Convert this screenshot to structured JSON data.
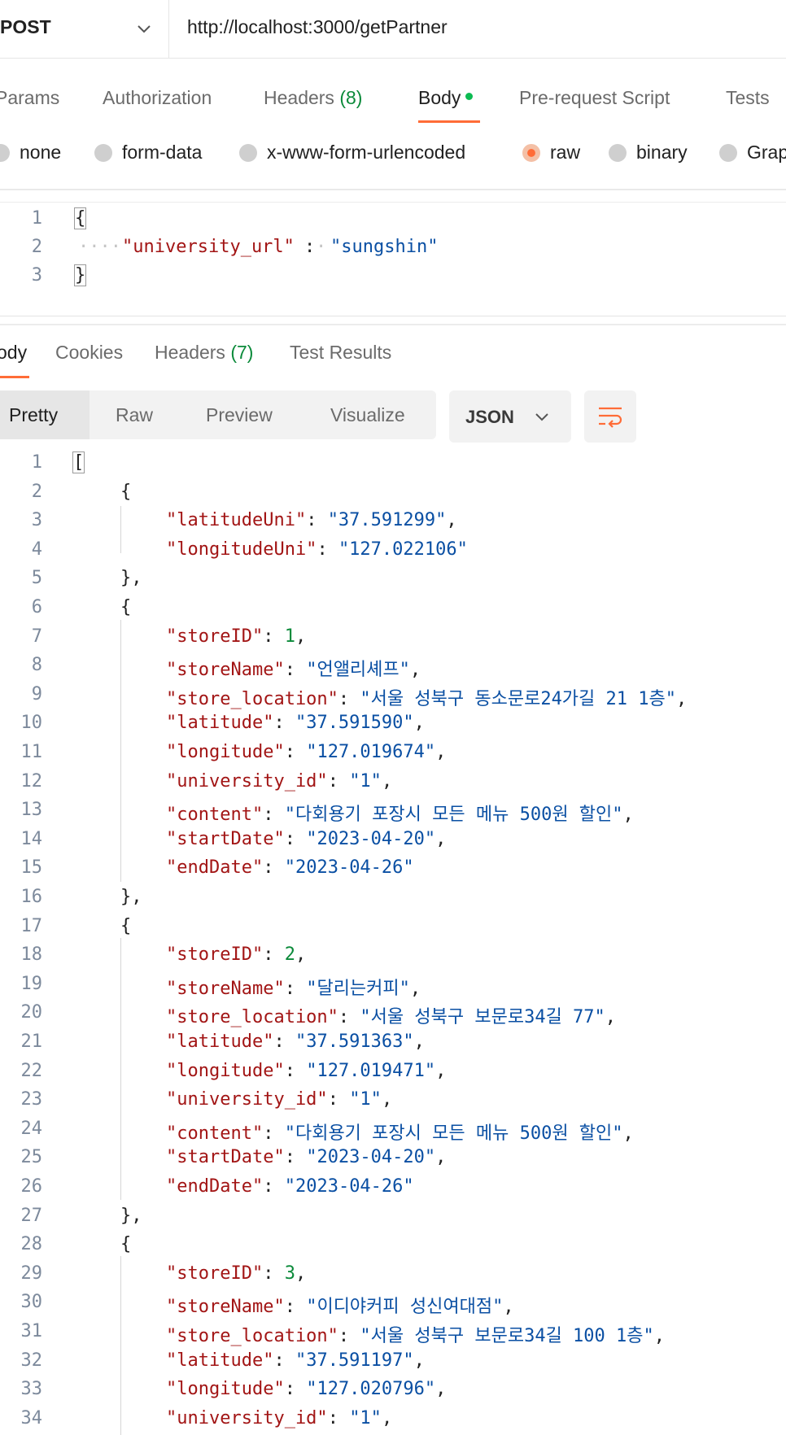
{
  "request": {
    "method": "POST",
    "url": "http://localhost:3000/getPartner"
  },
  "request_tabs": [
    {
      "label": "Params",
      "count": ""
    },
    {
      "label": "Authorization",
      "count": ""
    },
    {
      "label": "Headers",
      "count": "(8)"
    },
    {
      "label": "Body",
      "count": ""
    },
    {
      "label": "Pre-request Script",
      "count": ""
    },
    {
      "label": "Tests",
      "count": ""
    }
  ],
  "active_request_tab": "Body",
  "body_types": [
    "none",
    "form-data",
    "x-www-form-urlencoded",
    "raw",
    "binary",
    "Grap"
  ],
  "selected_body_type": "raw",
  "request_body": {
    "line_numbers": [
      "1",
      "2",
      "3"
    ],
    "open": "{",
    "key": "\"university_url\"",
    "colon": ":",
    "value": "\"sungshin\"",
    "close": "}"
  },
  "response_tabs": [
    {
      "label": "ody",
      "count": ""
    },
    {
      "label": "Cookies",
      "count": ""
    },
    {
      "label": "Headers",
      "count": "(7)"
    },
    {
      "label": "Test Results",
      "count": ""
    }
  ],
  "view_modes": [
    "Pretty",
    "Raw",
    "Preview",
    "Visualize"
  ],
  "active_view_mode": "Pretty",
  "format": "JSON",
  "icons": {
    "method_dropdown": "chevron-down-icon",
    "format_dropdown": "chevron-down-icon",
    "wrap": "wrap-lines-icon"
  },
  "colors": {
    "accent": "#ff6c37",
    "json_key": "#a21515",
    "json_string": "#0a4fa3",
    "json_number": "#0b8a3a",
    "count": "#0b8a3a",
    "dot": "#0cbb52"
  },
  "response_lines": [
    {
      "n": "1",
      "indent": 0,
      "parts": [
        [
          "punc",
          "["
        ]
      ]
    },
    {
      "n": "2",
      "indent": 1,
      "parts": [
        [
          "punc",
          "{"
        ]
      ]
    },
    {
      "n": "3",
      "indent": 2,
      "parts": [
        [
          "key",
          "\"latitudeUni\""
        ],
        [
          "punc",
          ": "
        ],
        [
          "str",
          "\"37.591299\""
        ],
        [
          "punc",
          ","
        ]
      ]
    },
    {
      "n": "4",
      "indent": 2,
      "parts": [
        [
          "key",
          "\"longitudeUni\""
        ],
        [
          "punc",
          ": "
        ],
        [
          "str",
          "\"127.022106\""
        ]
      ]
    },
    {
      "n": "5",
      "indent": 1,
      "parts": [
        [
          "punc",
          "},"
        ]
      ]
    },
    {
      "n": "6",
      "indent": 1,
      "parts": [
        [
          "punc",
          "{"
        ]
      ]
    },
    {
      "n": "7",
      "indent": 2,
      "parts": [
        [
          "key",
          "\"storeID\""
        ],
        [
          "punc",
          ": "
        ],
        [
          "num",
          "1"
        ],
        [
          "punc",
          ","
        ]
      ]
    },
    {
      "n": "8",
      "indent": 2,
      "parts": [
        [
          "key",
          "\"storeName\""
        ],
        [
          "punc",
          ": "
        ],
        [
          "str",
          "\"언앨리셰프\""
        ],
        [
          "punc",
          ","
        ]
      ]
    },
    {
      "n": "9",
      "indent": 2,
      "parts": [
        [
          "key",
          "\"store_location\""
        ],
        [
          "punc",
          ": "
        ],
        [
          "str",
          "\"서울 성북구 동소문로24가길 21 1층\""
        ],
        [
          "punc",
          ","
        ]
      ]
    },
    {
      "n": "10",
      "indent": 2,
      "parts": [
        [
          "key",
          "\"latitude\""
        ],
        [
          "punc",
          ": "
        ],
        [
          "str",
          "\"37.591590\""
        ],
        [
          "punc",
          ","
        ]
      ]
    },
    {
      "n": "11",
      "indent": 2,
      "parts": [
        [
          "key",
          "\"longitude\""
        ],
        [
          "punc",
          ": "
        ],
        [
          "str",
          "\"127.019674\""
        ],
        [
          "punc",
          ","
        ]
      ]
    },
    {
      "n": "12",
      "indent": 2,
      "parts": [
        [
          "key",
          "\"university_id\""
        ],
        [
          "punc",
          ": "
        ],
        [
          "str",
          "\"1\""
        ],
        [
          "punc",
          ","
        ]
      ]
    },
    {
      "n": "13",
      "indent": 2,
      "parts": [
        [
          "key",
          "\"content\""
        ],
        [
          "punc",
          ": "
        ],
        [
          "str",
          "\"다회용기 포장시 모든 메뉴 500원 할인\""
        ],
        [
          "punc",
          ","
        ]
      ]
    },
    {
      "n": "14",
      "indent": 2,
      "parts": [
        [
          "key",
          "\"startDate\""
        ],
        [
          "punc",
          ": "
        ],
        [
          "str",
          "\"2023-04-20\""
        ],
        [
          "punc",
          ","
        ]
      ]
    },
    {
      "n": "15",
      "indent": 2,
      "parts": [
        [
          "key",
          "\"endDate\""
        ],
        [
          "punc",
          ": "
        ],
        [
          "str",
          "\"2023-04-26\""
        ]
      ]
    },
    {
      "n": "16",
      "indent": 1,
      "parts": [
        [
          "punc",
          "},"
        ]
      ]
    },
    {
      "n": "17",
      "indent": 1,
      "parts": [
        [
          "punc",
          "{"
        ]
      ]
    },
    {
      "n": "18",
      "indent": 2,
      "parts": [
        [
          "key",
          "\"storeID\""
        ],
        [
          "punc",
          ": "
        ],
        [
          "num",
          "2"
        ],
        [
          "punc",
          ","
        ]
      ]
    },
    {
      "n": "19",
      "indent": 2,
      "parts": [
        [
          "key",
          "\"storeName\""
        ],
        [
          "punc",
          ": "
        ],
        [
          "str",
          "\"달리는커피\""
        ],
        [
          "punc",
          ","
        ]
      ]
    },
    {
      "n": "20",
      "indent": 2,
      "parts": [
        [
          "key",
          "\"store_location\""
        ],
        [
          "punc",
          ": "
        ],
        [
          "str",
          "\"서울 성북구 보문로34길 77\""
        ],
        [
          "punc",
          ","
        ]
      ]
    },
    {
      "n": "21",
      "indent": 2,
      "parts": [
        [
          "key",
          "\"latitude\""
        ],
        [
          "punc",
          ": "
        ],
        [
          "str",
          "\"37.591363\""
        ],
        [
          "punc",
          ","
        ]
      ]
    },
    {
      "n": "22",
      "indent": 2,
      "parts": [
        [
          "key",
          "\"longitude\""
        ],
        [
          "punc",
          ": "
        ],
        [
          "str",
          "\"127.019471\""
        ],
        [
          "punc",
          ","
        ]
      ]
    },
    {
      "n": "23",
      "indent": 2,
      "parts": [
        [
          "key",
          "\"university_id\""
        ],
        [
          "punc",
          ": "
        ],
        [
          "str",
          "\"1\""
        ],
        [
          "punc",
          ","
        ]
      ]
    },
    {
      "n": "24",
      "indent": 2,
      "parts": [
        [
          "key",
          "\"content\""
        ],
        [
          "punc",
          ": "
        ],
        [
          "str",
          "\"다회용기 포장시 모든 메뉴 500원 할인\""
        ],
        [
          "punc",
          ","
        ]
      ]
    },
    {
      "n": "25",
      "indent": 2,
      "parts": [
        [
          "key",
          "\"startDate\""
        ],
        [
          "punc",
          ": "
        ],
        [
          "str",
          "\"2023-04-20\""
        ],
        [
          "punc",
          ","
        ]
      ]
    },
    {
      "n": "26",
      "indent": 2,
      "parts": [
        [
          "key",
          "\"endDate\""
        ],
        [
          "punc",
          ": "
        ],
        [
          "str",
          "\"2023-04-26\""
        ]
      ]
    },
    {
      "n": "27",
      "indent": 1,
      "parts": [
        [
          "punc",
          "},"
        ]
      ]
    },
    {
      "n": "28",
      "indent": 1,
      "parts": [
        [
          "punc",
          "{"
        ]
      ]
    },
    {
      "n": "29",
      "indent": 2,
      "parts": [
        [
          "key",
          "\"storeID\""
        ],
        [
          "punc",
          ": "
        ],
        [
          "num",
          "3"
        ],
        [
          "punc",
          ","
        ]
      ]
    },
    {
      "n": "30",
      "indent": 2,
      "parts": [
        [
          "key",
          "\"storeName\""
        ],
        [
          "punc",
          ": "
        ],
        [
          "str",
          "\"이디야커피 성신여대점\""
        ],
        [
          "punc",
          ","
        ]
      ]
    },
    {
      "n": "31",
      "indent": 2,
      "parts": [
        [
          "key",
          "\"store_location\""
        ],
        [
          "punc",
          ": "
        ],
        [
          "str",
          "\"서울 성북구 보문로34길 100 1층\""
        ],
        [
          "punc",
          ","
        ]
      ]
    },
    {
      "n": "32",
      "indent": 2,
      "parts": [
        [
          "key",
          "\"latitude\""
        ],
        [
          "punc",
          ": "
        ],
        [
          "str",
          "\"37.591197\""
        ],
        [
          "punc",
          ","
        ]
      ]
    },
    {
      "n": "33",
      "indent": 2,
      "parts": [
        [
          "key",
          "\"longitude\""
        ],
        [
          "punc",
          ": "
        ],
        [
          "str",
          "\"127.020796\""
        ],
        [
          "punc",
          ","
        ]
      ]
    },
    {
      "n": "34",
      "indent": 2,
      "parts": [
        [
          "key",
          "\"university_id\""
        ],
        [
          "punc",
          ": "
        ],
        [
          "str",
          "\"1\""
        ],
        [
          "punc",
          ","
        ]
      ]
    }
  ]
}
